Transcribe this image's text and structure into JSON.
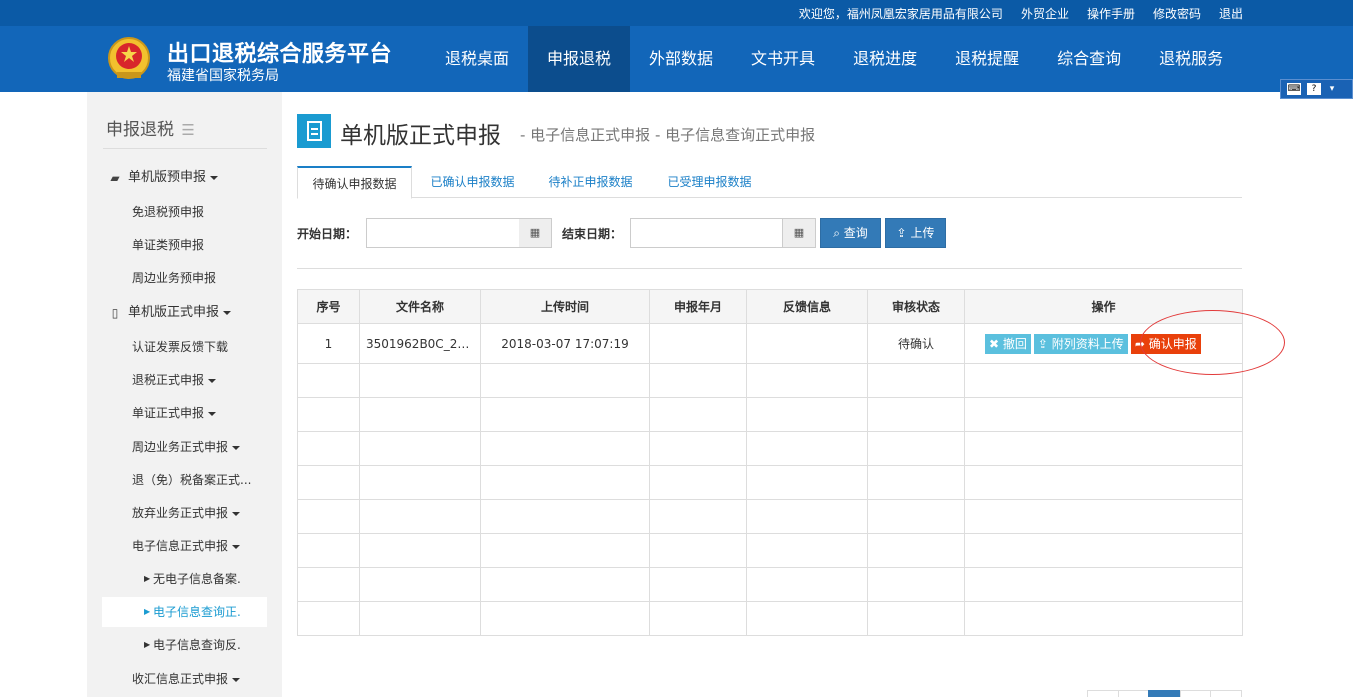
{
  "topbar": {
    "welcome": "欢迎您，福州凤凰宏家居用品有限公司",
    "links": [
      "外贸企业",
      "操作手册",
      "修改密码",
      "退出"
    ]
  },
  "header": {
    "title": "出口退税综合服务平台",
    "subtitle": "福建省国家税务局",
    "nav": [
      "退税桌面",
      "申报退税",
      "外部数据",
      "文书开具",
      "退税进度",
      "退税提醒",
      "综合查询",
      "退税服务"
    ],
    "active_nav": "申报退税"
  },
  "sidebar": {
    "title": "申报退税",
    "groups": {
      "pre": "单机版预申报",
      "pre_items": [
        "免退税预申报",
        "单证类预申报",
        "周边业务预申报"
      ],
      "formal": "单机版正式申报",
      "formal_items": [
        "认证发票反馈下载",
        "退税正式申报",
        "单证正式申报",
        "周边业务正式申报",
        "退（免）税备案正式...",
        "放弃业务正式申报",
        "电子信息正式申报"
      ],
      "einfo_items": [
        "无电子信息备案.",
        "电子信息查询正.",
        "电子信息查询反."
      ],
      "last": "收汇信息正式申报"
    }
  },
  "page": {
    "title": "单机版正式申报",
    "breadcrumb": "- 电子信息正式申报 - 电子信息查询正式申报",
    "tabs": [
      "待确认申报数据",
      "已确认申报数据",
      "待补正申报数据",
      "已受理申报数据"
    ],
    "filter": {
      "start_label": "开始日期：",
      "end_label": "结束日期：",
      "start_value": "",
      "end_value": "",
      "query_label": "查询",
      "upload_label": "上传"
    }
  },
  "table": {
    "headers": [
      "序号",
      "文件名称",
      "上传时间",
      "申报年月",
      "反馈信息",
      "审核状态",
      "操作"
    ],
    "rows": [
      {
        "no": "1",
        "file": "3501962B0C_20...",
        "time": "2018-03-07 17:07:19",
        "period": "",
        "feedback": "",
        "status": "待确认"
      }
    ],
    "actions": {
      "revoke": "撤回",
      "attach": "附列资料上传",
      "confirm": "确认申报"
    }
  },
  "colors": {
    "brand": "#1266b9",
    "accent": "#1a9bd1",
    "danger": "#e9400b",
    "primary": "#337ab7"
  }
}
